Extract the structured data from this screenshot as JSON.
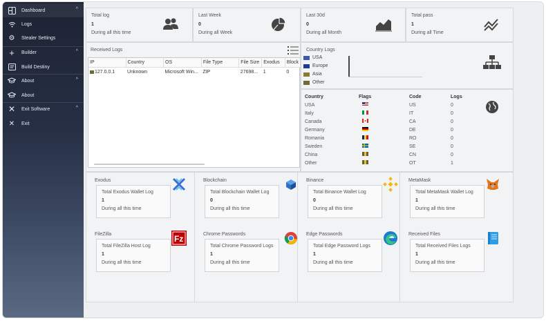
{
  "sidebar": {
    "items": [
      {
        "label": "Dashboard",
        "icon": "dashboard-icon",
        "chevron": "^"
      },
      {
        "label": "Logs",
        "icon": "wifi-icon"
      },
      {
        "label": "Stealer Settings",
        "icon": "gear-icon"
      },
      {
        "label": "Builder",
        "icon": "plus-icon",
        "chevron": "^"
      },
      {
        "label": "Build Destiny",
        "icon": "build-icon"
      },
      {
        "label": "About",
        "icon": "graduation-cap-icon",
        "chevron": "^"
      },
      {
        "label": "About",
        "icon": "graduation-cap-icon"
      },
      {
        "label": "Exit Software",
        "icon": "close-icon",
        "chevron": "^"
      },
      {
        "label": "Exit",
        "icon": "close-icon"
      }
    ]
  },
  "stats": [
    {
      "title": "Total log",
      "value": "1",
      "sub": "During all this time",
      "icon": "users-icon"
    },
    {
      "title": "Last Week",
      "value": "0",
      "sub": "During all Week",
      "icon": "pie-chart-icon"
    },
    {
      "title": "Last 30d",
      "value": "0",
      "sub": "During all Month",
      "icon": "area-chart-icon"
    },
    {
      "title": "Total pass",
      "value": "1",
      "sub": "During all Time",
      "icon": "trend-icon"
    }
  ],
  "received_logs": {
    "title": "Received Logs",
    "columns": [
      "IP",
      "Country",
      "OS",
      "File Type",
      "File Size",
      "Exodus",
      "Block"
    ],
    "rows": [
      [
        "127.0.0.1",
        "Unknown",
        "Microsoft Win...",
        "ZIP",
        "27698...",
        "1",
        "0"
      ]
    ]
  },
  "country_logs": {
    "title": "Country Logs",
    "legend": [
      {
        "label": "USA",
        "color": "#3c5aa8"
      },
      {
        "label": "Europe",
        "color": "#1f3d8f"
      },
      {
        "label": "Asia",
        "color": "#8a7a30"
      },
      {
        "label": "Other",
        "color": "#6f6a3a"
      }
    ]
  },
  "country_table": {
    "headers": [
      "Country",
      "Flags",
      "Code",
      "Logs"
    ],
    "rows": [
      {
        "country": "USA",
        "code": "US",
        "logs": "0",
        "flag": "flag-us-icon"
      },
      {
        "country": "Italy",
        "code": "IT",
        "logs": "0",
        "flag": "flag-it-icon"
      },
      {
        "country": "Canada",
        "code": "CA",
        "logs": "0",
        "flag": "flag-ca-icon"
      },
      {
        "country": "Germany",
        "code": "DE",
        "logs": "0",
        "flag": "flag-de-icon"
      },
      {
        "country": "Romania",
        "code": "RO",
        "logs": "0",
        "flag": "flag-ro-icon"
      },
      {
        "country": "Sweden",
        "code": "SE",
        "logs": "0",
        "flag": "flag-se-icon"
      },
      {
        "country": "China",
        "code": "CN",
        "logs": "0",
        "flag": "flag-cn-icon"
      },
      {
        "country": "Other",
        "code": "OT",
        "logs": "1",
        "flag": "flag-other-icon"
      }
    ]
  },
  "cards": [
    {
      "section": "Exodus",
      "title": "Total Exodus Wallet Log",
      "value": "1",
      "sub": "During all this time",
      "icon": "exodus-icon"
    },
    {
      "section": "Blockchain",
      "title": "Total Blockchain Wallet Log",
      "value": "0",
      "sub": "During all this time",
      "icon": "blockchain-icon"
    },
    {
      "section": "Binance",
      "title": "Total Binance Wallet Log",
      "value": "0",
      "sub": "During all this time",
      "icon": "binance-icon"
    },
    {
      "section": "MetaMask",
      "title": "Total MetaMask Wallet Log",
      "value": "1",
      "sub": "During all this time",
      "icon": "metamask-icon"
    },
    {
      "section": "FileZilla",
      "title": "Total FileZilla Host  Log",
      "value": "1",
      "sub": "During all this time",
      "icon": "filezilla-icon"
    },
    {
      "section": "Chrome Passwords",
      "title": "Total Chrome Password Logs",
      "value": "1",
      "sub": "During all this time",
      "icon": "chrome-icon"
    },
    {
      "section": "Edge Passwords",
      "title": "Total Edge Password Logs",
      "value": "1",
      "sub": "During all this time",
      "icon": "edge-icon"
    },
    {
      "section": "Received Files",
      "title": "Total Received Files Logs",
      "value": "1",
      "sub": "During all this time",
      "icon": "notebook-icon"
    }
  ]
}
